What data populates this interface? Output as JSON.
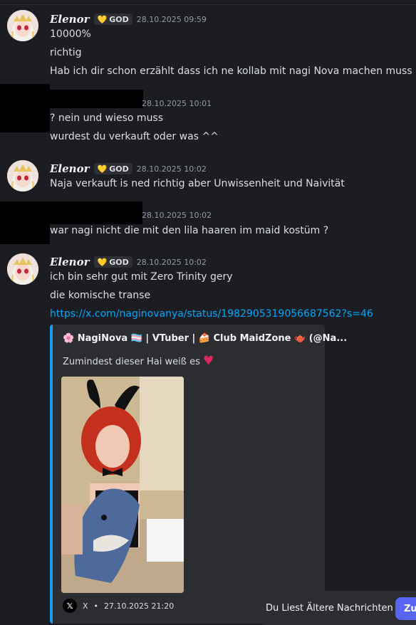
{
  "messages": {
    "m1": {
      "username": "Elenor",
      "tag": "GOD",
      "timestamp": "28.10.2025 09:59",
      "lines": [
        "10000%",
        "richtig",
        "Hab ich dir schon erzählt dass ich ne kollab mit nagi Nova machen muss"
      ]
    },
    "m2": {
      "timestamp": "28.10.2025 10:01",
      "lines": [
        "? nein und wieso muss",
        "wurdest du verkauft oder was ^^"
      ]
    },
    "m3": {
      "username": "Elenor",
      "tag": "GOD",
      "timestamp": "28.10.2025 10:02",
      "lines": [
        "Naja verkauft is ned richtig aber Unwissenheit und Naivität"
      ]
    },
    "m4": {
      "timestamp": "28.10.2025 10:02",
      "lines": [
        "war nagi nicht die mit den lila haaren im maid kostüm ?"
      ]
    },
    "m5": {
      "username": "Elenor",
      "tag": "GOD",
      "timestamp": "28.10.2025 10:02",
      "lines": [
        "ich bin sehr gut mit Zero Trinity gery",
        "die komische transe"
      ],
      "link": "https://x.com/naginovanya/status/1982905319056687562?s=46"
    }
  },
  "embed": {
    "author": "🌸 NagiNova 🏳️‍⚧️ | VTuber | 🍰 Club MaidZone 🫖 (@Na...",
    "description": "Zumindest dieser Hai weiß es",
    "heart": "♥",
    "footer_source": "X",
    "footer_date": "27.10.2025 21:20",
    "accent_color": "#1d9bf0"
  },
  "toast": {
    "label": "Du Liest Ältere Nachrichten",
    "button_label": "Zu"
  },
  "icons": {
    "avatar": "anime-avatar-icon",
    "tag": "heart-icon",
    "x": "x-logo-icon"
  }
}
